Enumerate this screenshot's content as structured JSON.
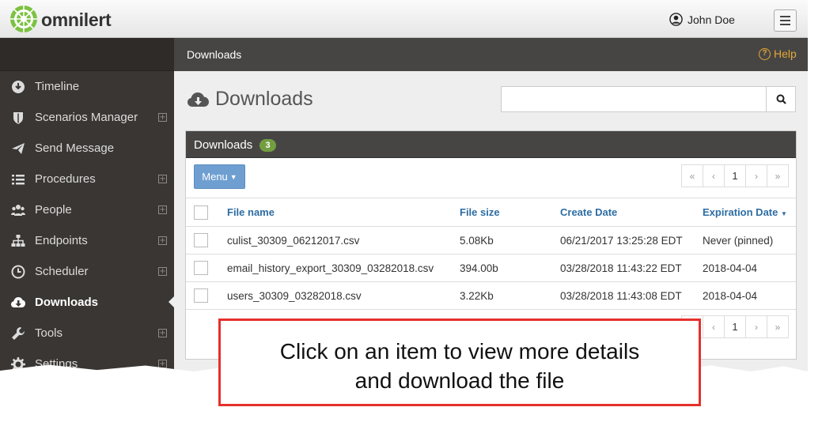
{
  "header": {
    "brand": "omnilert",
    "user_name": "John Doe"
  },
  "sidebar": {
    "items": [
      {
        "label": "Timeline",
        "icon": "clock-down-icon",
        "expandable": false
      },
      {
        "label": "Scenarios Manager",
        "icon": "shield-icon",
        "expandable": true
      },
      {
        "label": "Send Message",
        "icon": "paper-plane-icon",
        "expandable": false
      },
      {
        "label": "Procedures",
        "icon": "list-icon",
        "expandable": true
      },
      {
        "label": "People",
        "icon": "users-icon",
        "expandable": true
      },
      {
        "label": "Endpoints",
        "icon": "sitemap-icon",
        "expandable": true
      },
      {
        "label": "Scheduler",
        "icon": "clock-icon",
        "expandable": true
      },
      {
        "label": "Downloads",
        "icon": "cloud-download-icon",
        "expandable": false,
        "active": true
      },
      {
        "label": "Tools",
        "icon": "wrench-icon",
        "expandable": true
      },
      {
        "label": "Settings",
        "icon": "gear-icon",
        "expandable": true
      }
    ]
  },
  "breadcrumb": {
    "label": "Downloads",
    "help_label": "Help"
  },
  "page": {
    "title": "Downloads",
    "search_placeholder": ""
  },
  "panel": {
    "title": "Downloads",
    "count": "3",
    "menu_label": "Menu",
    "pager": {
      "first": "«",
      "prev": "‹",
      "current": "1",
      "next": "›",
      "last": "»"
    },
    "columns": {
      "file_name": "File name",
      "file_size": "File size",
      "create_date": "Create Date",
      "expiration_date": "Expiration Date"
    },
    "rows": [
      {
        "file_name": "culist_30309_06212017.csv",
        "file_size": "5.08Kb",
        "create_date": "06/21/2017 13:25:28 EDT",
        "expiration_date": "Never (pinned)"
      },
      {
        "file_name": "email_history_export_30309_03282018.csv",
        "file_size": "394.00b",
        "create_date": "03/28/2018 11:43:22 EDT",
        "expiration_date": "2018-04-04"
      },
      {
        "file_name": "users_30309_03282018.csv",
        "file_size": "3.22Kb",
        "create_date": "03/28/2018 11:43:08 EDT",
        "expiration_date": "2018-04-04"
      }
    ]
  },
  "callout": {
    "line1": "Click on an item to view more details",
    "line2": "and download the file"
  },
  "colors": {
    "accent_blue": "#6f9fd1",
    "link_blue": "#2e6da4",
    "badge_green": "#739e40",
    "help_orange": "#e2a834",
    "callout_red": "#e6302b"
  }
}
